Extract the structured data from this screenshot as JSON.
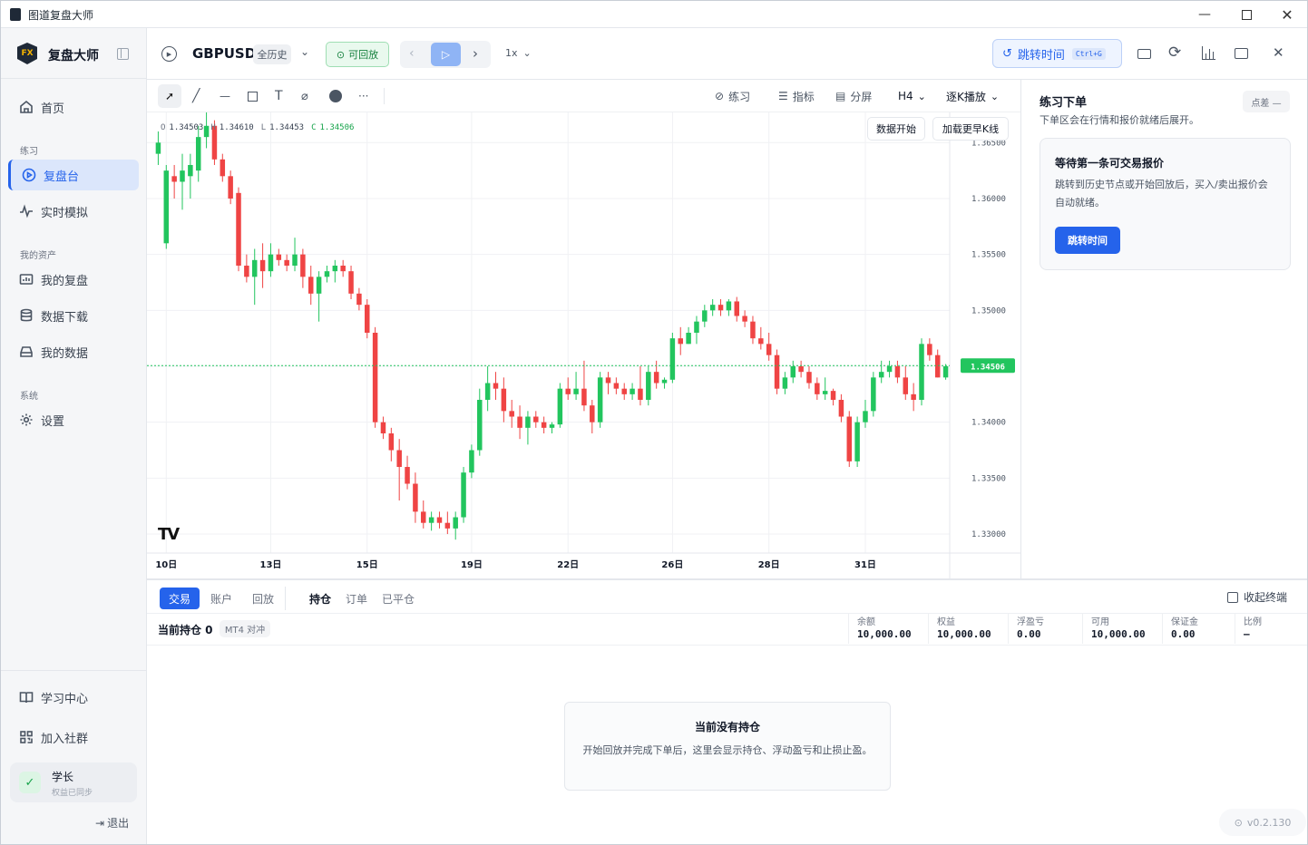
{
  "app": {
    "title": "图道复盘大师"
  },
  "sidebar": {
    "brand": "复盘大师",
    "logo_text": "FX",
    "home": "首页",
    "group_practice": "练习",
    "replay": "复盘台",
    "live_sim": "实时模拟",
    "group_assets": "我的资产",
    "my_replays": "我的复盘",
    "data_download": "数据下载",
    "my_data": "我的数据",
    "group_system": "系统",
    "settings": "设置",
    "learn_center": "学习中心",
    "join_community": "加入社群",
    "user_name": "学长",
    "user_status": "权益已同步",
    "logout": "退出"
  },
  "toolbar": {
    "symbol": "GBPUSD",
    "range": "全历史",
    "replay_status": "可回放",
    "speed": "1x",
    "jump_label": "跳转时间",
    "jump_shortcut": "Ctrl+G"
  },
  "chart_tools": {
    "practice": "练习",
    "indicators": "指标",
    "split": "分屏",
    "timeframe": "H4",
    "mode": "逐K播放"
  },
  "chart_overlay": {
    "o_label": "O",
    "o_value": "1.34503",
    "h_label": "H",
    "h_value": "1.34610",
    "l_label": "L",
    "l_value": "1.34453",
    "c_label": "C",
    "c_value": "1.34506",
    "data_start_btn": "数据开始",
    "load_earlier_btn": "加载更早K线",
    "logo": "TV"
  },
  "chart_data": {
    "type": "candlestick",
    "symbol": "GBPUSD",
    "timeframe": "H4",
    "ylim": [
      1.3283,
      1.3677
    ],
    "y_ticks": [
      1.365,
      1.36,
      1.355,
      1.35,
      1.345,
      1.34,
      1.335,
      1.33
    ],
    "y_tick_labels": [
      "1.36500",
      "1.36000",
      "1.35500",
      "1.35000",
      "1.34500",
      "1.34000",
      "1.33500",
      "1.33000"
    ],
    "x_tick_labels": [
      "10日",
      "13日",
      "15日",
      "19日",
      "22日",
      "26日",
      "28日",
      "31日"
    ],
    "x_tick_index": [
      1,
      14,
      26,
      39,
      51,
      64,
      76,
      88
    ],
    "last_price": 1.34506,
    "last_price_label": "1.34506",
    "candles": [
      [
        1.364,
        1.366,
        1.363,
        1.365
      ],
      [
        1.356,
        1.363,
        1.3555,
        1.3625
      ],
      [
        1.362,
        1.363,
        1.36,
        1.3615
      ],
      [
        1.3615,
        1.364,
        1.359,
        1.3625
      ],
      [
        1.362,
        1.364,
        1.36,
        1.363
      ],
      [
        1.3625,
        1.3665,
        1.3615,
        1.3655
      ],
      [
        1.3655,
        1.368,
        1.3645,
        1.3665
      ],
      [
        1.3665,
        1.367,
        1.363,
        1.3635
      ],
      [
        1.3635,
        1.364,
        1.3615,
        1.362
      ],
      [
        1.362,
        1.3625,
        1.3595,
        1.36
      ],
      [
        1.3605,
        1.361,
        1.3535,
        1.354
      ],
      [
        1.354,
        1.355,
        1.3525,
        1.353
      ],
      [
        1.353,
        1.3555,
        1.3505,
        1.3545
      ],
      [
        1.3545,
        1.356,
        1.352,
        1.3535
      ],
      [
        1.3535,
        1.356,
        1.353,
        1.355
      ],
      [
        1.355,
        1.3555,
        1.354,
        1.3545
      ],
      [
        1.3545,
        1.355,
        1.3535,
        1.354
      ],
      [
        1.354,
        1.3565,
        1.3535,
        1.355
      ],
      [
        1.355,
        1.3555,
        1.352,
        1.353
      ],
      [
        1.353,
        1.354,
        1.3505,
        1.3515
      ],
      [
        1.3515,
        1.3535,
        1.349,
        1.353
      ],
      [
        1.353,
        1.354,
        1.3525,
        1.3535
      ],
      [
        1.3535,
        1.3545,
        1.3525,
        1.354
      ],
      [
        1.354,
        1.3545,
        1.353,
        1.3535
      ],
      [
        1.3535,
        1.354,
        1.351,
        1.3515
      ],
      [
        1.3515,
        1.352,
        1.35,
        1.3505
      ],
      [
        1.3505,
        1.351,
        1.3475,
        1.348
      ],
      [
        1.348,
        1.3485,
        1.3395,
        1.34
      ],
      [
        1.34,
        1.3405,
        1.3385,
        1.339
      ],
      [
        1.339,
        1.3395,
        1.3365,
        1.3375
      ],
      [
        1.3375,
        1.3385,
        1.333,
        1.336
      ],
      [
        1.336,
        1.337,
        1.334,
        1.3345
      ],
      [
        1.3345,
        1.3355,
        1.331,
        1.332
      ],
      [
        1.332,
        1.333,
        1.3305,
        1.331
      ],
      [
        1.331,
        1.332,
        1.3303,
        1.3315
      ],
      [
        1.3315,
        1.332,
        1.3305,
        1.331
      ],
      [
        1.331,
        1.332,
        1.33,
        1.3305
      ],
      [
        1.3305,
        1.332,
        1.3295,
        1.3315
      ],
      [
        1.3315,
        1.336,
        1.331,
        1.3355
      ],
      [
        1.3355,
        1.338,
        1.335,
        1.3375
      ],
      [
        1.3375,
        1.343,
        1.337,
        1.342
      ],
      [
        1.342,
        1.345,
        1.341,
        1.3435
      ],
      [
        1.3435,
        1.3445,
        1.342,
        1.343
      ],
      [
        1.343,
        1.344,
        1.34,
        1.341
      ],
      [
        1.341,
        1.342,
        1.3395,
        1.3405
      ],
      [
        1.3405,
        1.3415,
        1.3385,
        1.3395
      ],
      [
        1.3395,
        1.341,
        1.338,
        1.3405
      ],
      [
        1.3405,
        1.341,
        1.3395,
        1.34
      ],
      [
        1.34,
        1.3405,
        1.339,
        1.3395
      ],
      [
        1.3395,
        1.34,
        1.339,
        1.3398
      ],
      [
        1.3398,
        1.3435,
        1.3395,
        1.343
      ],
      [
        1.343,
        1.344,
        1.342,
        1.3425
      ],
      [
        1.3425,
        1.3445,
        1.342,
        1.343
      ],
      [
        1.343,
        1.3455,
        1.341,
        1.3415
      ],
      [
        1.3415,
        1.342,
        1.339,
        1.34
      ],
      [
        1.34,
        1.3445,
        1.3395,
        1.344
      ],
      [
        1.344,
        1.3445,
        1.3425,
        1.3435
      ],
      [
        1.3435,
        1.344,
        1.3425,
        1.343
      ],
      [
        1.343,
        1.3435,
        1.342,
        1.3425
      ],
      [
        1.3425,
        1.3435,
        1.342,
        1.343
      ],
      [
        1.343,
        1.345,
        1.3415,
        1.342
      ],
      [
        1.342,
        1.345,
        1.3415,
        1.3445
      ],
      [
        1.3445,
        1.3455,
        1.343,
        1.3435
      ],
      [
        1.3435,
        1.344,
        1.343,
        1.3438
      ],
      [
        1.3438,
        1.348,
        1.3435,
        1.3475
      ],
      [
        1.3475,
        1.3485,
        1.346,
        1.347
      ],
      [
        1.347,
        1.3485,
        1.347,
        1.348
      ],
      [
        1.348,
        1.3495,
        1.347,
        1.349
      ],
      [
        1.349,
        1.3505,
        1.3485,
        1.35
      ],
      [
        1.35,
        1.351,
        1.3495,
        1.3505
      ],
      [
        1.3505,
        1.351,
        1.3495,
        1.35
      ],
      [
        1.35,
        1.351,
        1.3495,
        1.3508
      ],
      [
        1.3508,
        1.3512,
        1.349,
        1.3495
      ],
      [
        1.3495,
        1.35,
        1.3485,
        1.349
      ],
      [
        1.349,
        1.3495,
        1.347,
        1.3475
      ],
      [
        1.3475,
        1.3485,
        1.3465,
        1.347
      ],
      [
        1.347,
        1.348,
        1.3455,
        1.346
      ],
      [
        1.346,
        1.3465,
        1.3425,
        1.343
      ],
      [
        1.343,
        1.3445,
        1.3425,
        1.344
      ],
      [
        1.344,
        1.3455,
        1.3435,
        1.345
      ],
      [
        1.345,
        1.3455,
        1.344,
        1.3445
      ],
      [
        1.3445,
        1.345,
        1.343,
        1.3435
      ],
      [
        1.3435,
        1.344,
        1.342,
        1.3425
      ],
      [
        1.3425,
        1.344,
        1.342,
        1.3428
      ],
      [
        1.3428,
        1.343,
        1.3415,
        1.342
      ],
      [
        1.342,
        1.3425,
        1.34,
        1.3405
      ],
      [
        1.3405,
        1.341,
        1.336,
        1.3365
      ],
      [
        1.3365,
        1.3405,
        1.336,
        1.34
      ],
      [
        1.34,
        1.342,
        1.3395,
        1.341
      ],
      [
        1.341,
        1.3445,
        1.3405,
        1.344
      ],
      [
        1.344,
        1.3455,
        1.3435,
        1.3445
      ],
      [
        1.3445,
        1.3455,
        1.344,
        1.345
      ],
      [
        1.345,
        1.3455,
        1.3435,
        1.344
      ],
      [
        1.344,
        1.345,
        1.342,
        1.3425
      ],
      [
        1.3425,
        1.3435,
        1.341,
        1.342
      ],
      [
        1.342,
        1.3475,
        1.3415,
        1.347
      ],
      [
        1.347,
        1.3475,
        1.3455,
        1.346
      ],
      [
        1.346,
        1.3465,
        1.344,
        1.344
      ],
      [
        1.344,
        1.3452,
        1.3438,
        1.345
      ]
    ]
  },
  "order_panel": {
    "title": "练习下单",
    "spread_btn": "点差 —",
    "subtitle": "下单区会在行情和报价就绪后展开。",
    "card_title": "等待第一条可交易报价",
    "card_desc": "跳转到历史节点或开始回放后，买入/卖出报价会自动就绪。",
    "card_btn": "跳转时间"
  },
  "bottom": {
    "tabs_left": [
      "交易",
      "账户",
      "回放"
    ],
    "tabs_right": [
      "持仓",
      "订单",
      "已平仓"
    ],
    "collapse": "收起终端",
    "positions_label": "当前持仓 0",
    "account_mode": "MT4 对冲",
    "stats": [
      {
        "label": "余额",
        "value": "10,000.00"
      },
      {
        "label": "权益",
        "value": "10,000.00"
      },
      {
        "label": "浮盈亏",
        "value": "0.00"
      },
      {
        "label": "可用",
        "value": "10,000.00"
      },
      {
        "label": "保证金",
        "value": "0.00"
      },
      {
        "label": "比例",
        "value": "—"
      }
    ],
    "empty_title": "当前没有持仓",
    "empty_desc": "开始回放并完成下单后，这里会显示持仓、浮动盈亏和止损止盈。",
    "version": "v0.2.130"
  },
  "colors": {
    "up": "#22c55e",
    "down": "#ef4444",
    "accent": "#2563eb"
  }
}
